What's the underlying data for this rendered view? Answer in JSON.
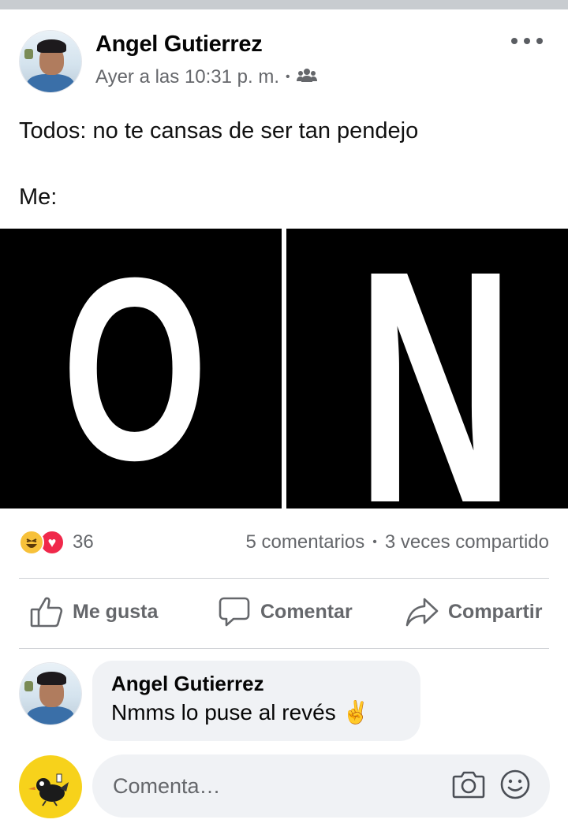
{
  "post": {
    "author": "Angel Gutierrez",
    "timestamp": "Ayer a las 10:31 p. m.",
    "separator": "•",
    "audience_icon": "friends-icon",
    "text_line_1": "Todos: no te cansas de ser tan pendejo",
    "text_line_2": "Me:",
    "image_letters": [
      "O",
      "N"
    ]
  },
  "stats": {
    "reaction_icons": [
      "haha-icon",
      "love-icon"
    ],
    "reaction_count": "36",
    "comments": "5 comentarios",
    "separator": "•",
    "shares": "3 veces compartido"
  },
  "actions": {
    "like": "Me gusta",
    "comment": "Comentar",
    "share": "Compartir"
  },
  "comment": {
    "author": "Angel Gutierrez",
    "text": "Nmms lo puse al revés ✌️"
  },
  "composer": {
    "placeholder": "Comenta…"
  },
  "colors": {
    "secondary_text": "#65676b",
    "bubble_bg": "#f0f2f5",
    "love": "#f0284a",
    "haha": "#f7c13a"
  }
}
